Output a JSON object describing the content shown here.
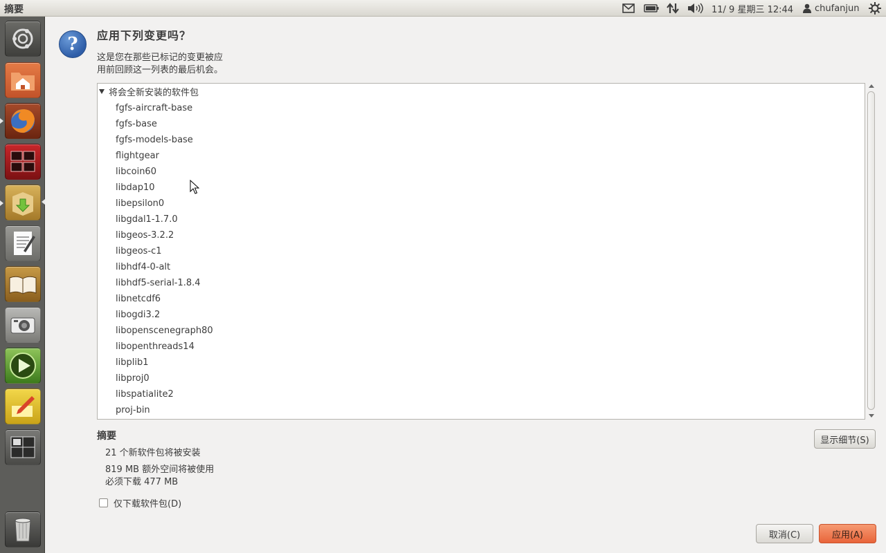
{
  "window_title": "摘要",
  "panel": {
    "datetime": "11/ 9 星期三 12:44",
    "user": "chufanjun"
  },
  "dialog": {
    "heading": "应用下列变更吗？",
    "description_line1": "这是您在那些已标记的变更被应",
    "description_line2": "用前回顾这一列表的最后机会。",
    "group_label": "将会全新安装的软件包",
    "packages": [
      "fgfs-aircraft-base",
      "fgfs-base",
      "fgfs-models-base",
      "flightgear",
      "libcoin60",
      "libdap10",
      "libepsilon0",
      "libgdal1-1.7.0",
      "libgeos-3.2.2",
      "libgeos-c1",
      "libhdf4-0-alt",
      "libhdf5-serial-1.8.4",
      "libnetcdf6",
      "libogdi3.2",
      "libopenscenegraph80",
      "libopenthreads14",
      "libplib1",
      "libproj0",
      "libspatialite2",
      "proj-bin"
    ],
    "summary_heading": "摘要",
    "summary_new": "21 个新软件包将被安装",
    "summary_space": "819 MB 额外空间将被使用",
    "summary_download": "必须下载 477 MB",
    "details_button": "显示细节(S)",
    "download_only_label": "仅下载软件包(D)",
    "download_only_checked": false,
    "cancel_button": "取消(C)",
    "apply_button": "应用(A)"
  },
  "launcher_items": [
    "dash-icon",
    "home-folder-icon",
    "firefox-icon",
    "workspace-switcher-icon",
    "software-center-icon",
    "text-editor-icon",
    "dictionary-icon",
    "screenshot-camera-icon",
    "media-player-icon",
    "notes-icon",
    "workspaces-icon",
    "trash-icon"
  ],
  "colors": {
    "accent": "#e8643a",
    "launcher_bg": "#5d5d5a",
    "dialog_bg": "#f2f1f0"
  }
}
